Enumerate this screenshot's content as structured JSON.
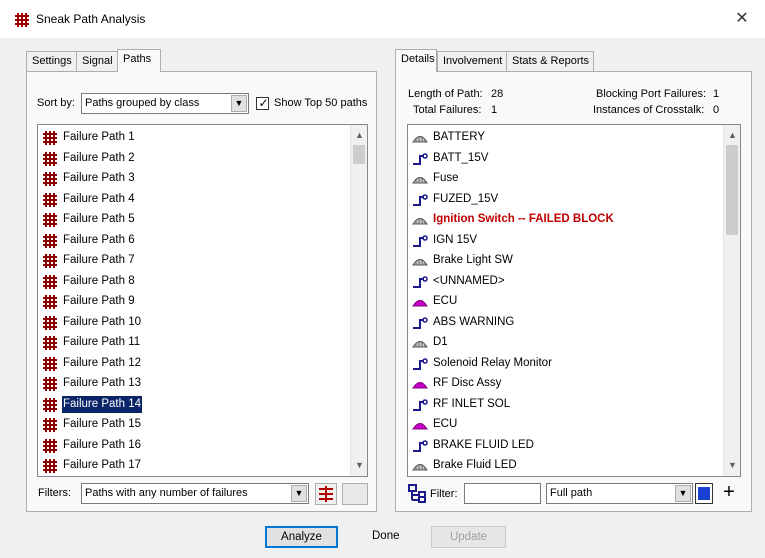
{
  "window": {
    "title": "Sneak Path Analysis",
    "close_glyph": "✕",
    "app_icon": "hash-grid-icon"
  },
  "left": {
    "tabs": [
      {
        "label": "Settings",
        "active": false
      },
      {
        "label": "Signal",
        "active": false
      },
      {
        "label": "Paths",
        "active": true
      }
    ],
    "sort_label": "Sort by:",
    "sort_value": "Paths grouped by class",
    "show_top_checked": true,
    "show_top_label": "Show Top 50 paths",
    "paths": [
      "Failure Path 1",
      "Failure Path 2",
      "Failure Path 3",
      "Failure Path 4",
      "Failure Path 5",
      "Failure Path 6",
      "Failure Path 7",
      "Failure Path 8",
      "Failure Path 9",
      "Failure Path 10",
      "Failure Path 11",
      "Failure Path 12",
      "Failure Path 13",
      "Failure Path 14",
      "Failure Path 15",
      "Failure Path 16",
      "Failure Path 17"
    ],
    "selected_path": "Failure Path 14",
    "filters_label": "Filters:",
    "filters_value": "Paths with any number of failures"
  },
  "right": {
    "tabs": [
      {
        "label": "Details",
        "active": true
      },
      {
        "label": "Involvement",
        "active": false
      },
      {
        "label": "Stats & Reports",
        "active": false
      }
    ],
    "stats": {
      "length_label": "Length of Path:",
      "length_value": "28",
      "total_label": "Total Failures:",
      "total_value": "1",
      "blocking_label": "Blocking Port Failures:",
      "blocking_value": "1",
      "crosstalk_label": "Instances of Crosstalk:",
      "crosstalk_value": "0"
    },
    "details": [
      {
        "label": "BATTERY",
        "icon": "component-gray"
      },
      {
        "label": "BATT_15V",
        "icon": "signal-wire"
      },
      {
        "label": "Fuse",
        "icon": "component-gray"
      },
      {
        "label": "FUZED_15V",
        "icon": "signal-wire"
      },
      {
        "label": "Ignition Switch -- FAILED BLOCK",
        "icon": "component-gray",
        "failed": true
      },
      {
        "label": "IGN 15V",
        "icon": "signal-wire"
      },
      {
        "label": "Brake Light SW",
        "icon": "component-gray"
      },
      {
        "label": "<UNNAMED>",
        "icon": "signal-wire"
      },
      {
        "label": "ECU",
        "icon": "component-magenta"
      },
      {
        "label": "ABS WARNING",
        "icon": "signal-wire"
      },
      {
        "label": "D1",
        "icon": "component-gray"
      },
      {
        "label": "Solenoid Relay Monitor",
        "icon": "signal-wire"
      },
      {
        "label": "RF Disc Assy",
        "icon": "component-magenta"
      },
      {
        "label": "RF INLET SOL",
        "icon": "signal-wire"
      },
      {
        "label": "ECU",
        "icon": "component-magenta"
      },
      {
        "label": "BRAKE FLUID LED",
        "icon": "signal-wire"
      },
      {
        "label": "Brake Fluid LED",
        "icon": "component-gray"
      }
    ],
    "filter_label": "Filter:",
    "filter_value": "",
    "filter_mode": "Full path",
    "color_swatch": "#1a3fd4",
    "add_glyph": "+"
  },
  "buttons": {
    "analyze": "Analyze",
    "done": "Done",
    "update": "Update"
  },
  "colors": {
    "selection": "#0a246a",
    "failed_text": "#c00000",
    "path_icon": "#8b0000",
    "wire_icon": "#1a1a8c",
    "magenta_component": "#e000e0"
  }
}
